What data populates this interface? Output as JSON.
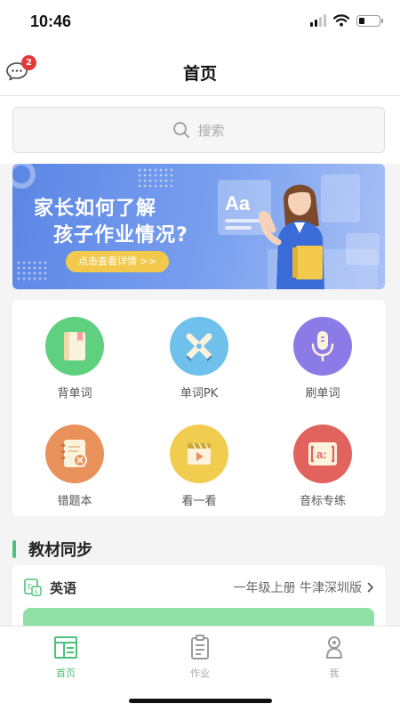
{
  "status_bar": {
    "time": "10:46",
    "signal_bars": 4,
    "signal_bars_active": 2,
    "battery_level": 0.3
  },
  "header": {
    "title": "首页",
    "message_icon": "chat-bubble-icon",
    "message_badge": "2"
  },
  "search": {
    "placeholder": "搜索",
    "icon": "search-icon"
  },
  "banner": {
    "line1": "家长如何了解",
    "line2": "孩子作业情况?",
    "button_label": "点击查看详情 >>",
    "letters": "Aa"
  },
  "features": [
    {
      "label": "背单词",
      "icon": "book-icon",
      "color": "#5fcf80"
    },
    {
      "label": "单词PK",
      "icon": "crossed-pens-icon",
      "color": "#6fc0ea"
    },
    {
      "label": "刷单词",
      "icon": "microphone-icon",
      "color": "#8b7be6"
    },
    {
      "label": "错题本",
      "icon": "notebook-wrong-icon",
      "color": "#e9915b"
    },
    {
      "label": "看一看",
      "icon": "video-play-icon",
      "color": "#f0cd4f"
    },
    {
      "label": "音标专练",
      "icon": "phonetic-icon",
      "color": "#e2635e"
    }
  ],
  "section": {
    "title": "教材同步"
  },
  "textbook": {
    "subject": "英语",
    "edition": "一年级上册 牛津深圳版",
    "icon": "english-book-icon"
  },
  "tabbar": {
    "items": [
      {
        "label": "首页",
        "icon": "home-icon",
        "active": true
      },
      {
        "label": "作业",
        "icon": "clipboard-icon",
        "active": false
      },
      {
        "label": "我",
        "icon": "user-icon",
        "active": false
      }
    ]
  },
  "colors": {
    "accent": "#4cc27a",
    "badge": "#e53935",
    "banner_button": "#f2c94c"
  }
}
